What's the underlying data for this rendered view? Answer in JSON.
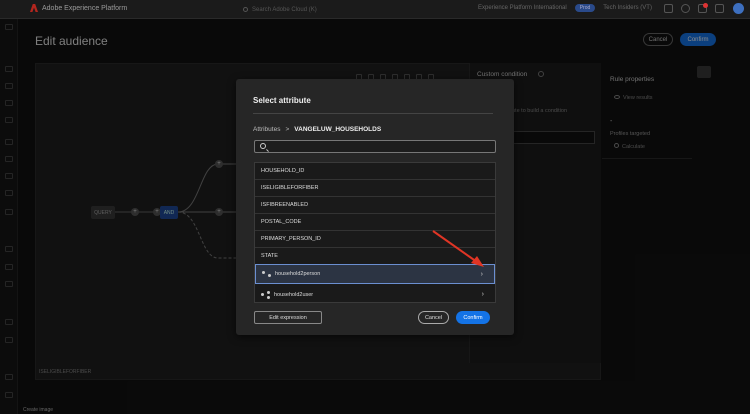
{
  "app": {
    "brand": "Adobe Experience Platform",
    "search_placeholder": "Search Adobe Cloud (K)",
    "sandbox": "Experience Platform International",
    "env_badge": "Prod",
    "org": "Tech Insiders (VT)"
  },
  "page": {
    "title": "Edit audience",
    "cancel_label": "Cancel",
    "confirm_label": "Confirm"
  },
  "canvas": {
    "query_node": "QUERY",
    "and_node": "AND",
    "plus": "+",
    "footer_label": "ISELIGIBLEFORFIBER"
  },
  "custom_condition": {
    "title": "Custom condition",
    "hint": "ute to build a condition"
  },
  "rule_properties": {
    "title": "Rule properties",
    "view_results": "View results",
    "value": "-",
    "profiles_label": "Profiles targeted",
    "calculate": "Calculate"
  },
  "modal": {
    "title": "Select attribute",
    "breadcrumb": {
      "root": "Attributes",
      "separator": ">",
      "current": "VANGELUW_HOUSEHOLDS"
    },
    "search_placeholder": "",
    "attributes": [
      {
        "label": "HOUSEHOLD_ID"
      },
      {
        "label": "ISELIGIBLEFORFIBER"
      },
      {
        "label": "ISFIBREENABLED"
      },
      {
        "label": "POSTAL_CODE"
      },
      {
        "label": "PRIMARY_PERSON_ID"
      },
      {
        "label": "STATE"
      }
    ],
    "relations": [
      {
        "label": "household2person",
        "chevron": "›"
      },
      {
        "label": "household2user",
        "chevron": "›"
      }
    ],
    "edit_expression_label": "Edit expression",
    "cancel_label": "Cancel",
    "confirm_label": "Confirm"
  },
  "footer": {
    "hint": "Create image"
  },
  "colors": {
    "accent": "#1473e6",
    "annotation_arrow": "#e03525",
    "selected_border": "#6b8fd1"
  }
}
